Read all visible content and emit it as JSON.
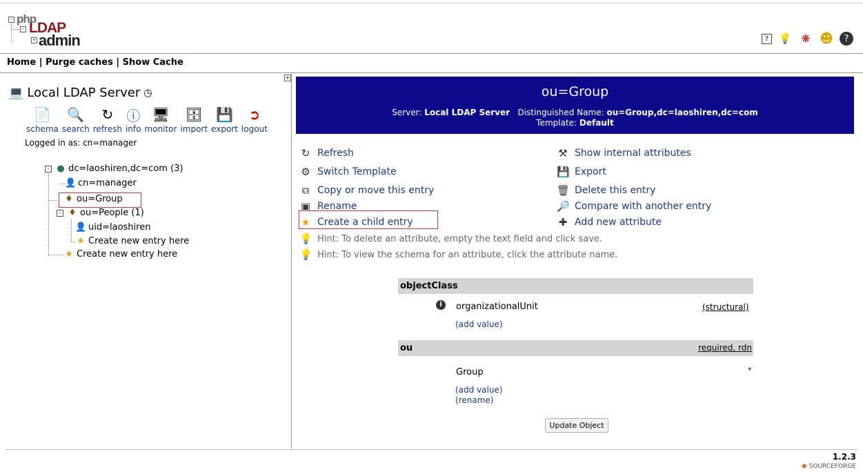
{
  "header": {
    "logo": {
      "php": "php",
      "ldap": "LDAP",
      "admin": "admin"
    },
    "icons": [
      "help-icon",
      "lightbulb-icon",
      "bug-icon",
      "smiley-icon",
      "info-question-icon"
    ]
  },
  "menu": {
    "home": "Home",
    "sep": " | ",
    "purge": "Purge caches",
    "show": "Show Cache"
  },
  "server": {
    "name": "Local LDAP Server",
    "logged_in": "Logged in as: cn=manager"
  },
  "toolbar": [
    "schema",
    "search",
    "refresh",
    "info",
    "monitor",
    "import",
    "export",
    "logout"
  ],
  "tree": {
    "root": "dc=laoshiren,dc=com (3)",
    "manager": "cn=manager",
    "group": "ou=Group",
    "people": "ou=People (1)",
    "uid": "uid=laoshiren",
    "create_inner": "Create new entry here",
    "create_outer": "Create new entry here"
  },
  "banner": {
    "title": "ou=Group",
    "server_label": "Server: ",
    "server_value": "Local LDAP Server",
    "dn_label": "Distinguished Name: ",
    "dn_value": "ou=Group,dc=laoshiren,dc=com",
    "template_label": "Template: ",
    "template_value": "Default"
  },
  "actions": {
    "refresh": "Refresh",
    "switch_template": "Switch Template",
    "copy_move": "Copy or move this entry",
    "rename": "Rename",
    "create_child": "Create a child entry",
    "show_internal": "Show internal attributes",
    "export": "Export",
    "delete": "Delete this entry",
    "compare": "Compare with another entry",
    "add_attribute": "Add new attribute",
    "hint1": "Hint: To delete an attribute, empty the text field and click save.",
    "hint2": "Hint: To view the schema for an attribute, click the attribute name."
  },
  "attributes": {
    "objectclass": {
      "name": "objectClass",
      "value": "organizationalUnit",
      "tag": "(structural)",
      "add": "(add value)"
    },
    "ou": {
      "name": "ou",
      "flags_required": "required",
      "flags_sep": ", ",
      "flags_rdn": "rdn",
      "value": "Group",
      "star": "*",
      "add": "(add value)",
      "rename": "(rename)"
    }
  },
  "update_button": "Update Object",
  "footer": {
    "version": "1.2.3",
    "sourceforge": "SOURCEFORGE"
  }
}
